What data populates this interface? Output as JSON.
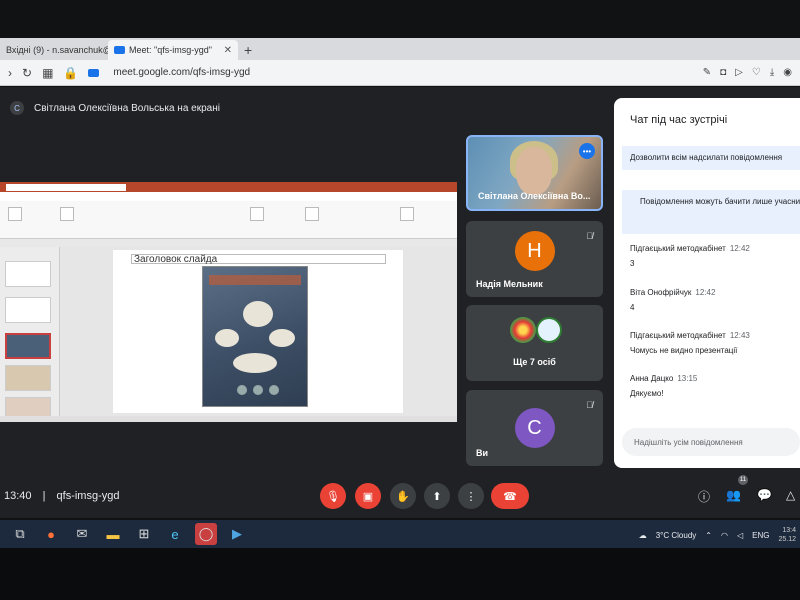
{
  "browser": {
    "tabs": [
      {
        "label": "Вхідні (9) - n.savanchuk@...",
        "active": false
      },
      {
        "label": "Meet: \"qfs-imsg-ygd\"",
        "active": true
      }
    ],
    "new_tab": "+",
    "url": "meet.google.com/qfs-imsg-ygd"
  },
  "meet": {
    "presenter_initial": "С",
    "presenting_text": "Світлана Олексіївна Вольська на екрані",
    "shared_slide_title": "Заголовок слайда",
    "tiles": [
      {
        "name": "Світлана Олексіївна Во...",
        "type": "video"
      },
      {
        "name": "Надія Мельник",
        "initial": "Н",
        "color": "#e8710a"
      },
      {
        "name": "Ще 7 осіб",
        "type": "group"
      },
      {
        "name": "Ви",
        "initial": "С",
        "color": "#7e57c2"
      }
    ],
    "meeting_time": "13:40",
    "meeting_code": "qfs-imsg-ygd",
    "participants_badge": "11",
    "chat": {
      "title": "Чат під час зустрічі",
      "toggle_label": "Дозволити всім надсилати повідомлення",
      "notice": "Повідомлення можуть бачити лише учасники зустрічі. Коли зустріч завершується, повідомлення видаляються.",
      "messages": [
        {
          "author": "Підгаєцький методкабінет",
          "time": "12:42",
          "text": "3"
        },
        {
          "author": "Віта Онофрійчук",
          "time": "12:42",
          "text": "4"
        },
        {
          "author": "Підгаєцький методкабінет",
          "time": "12:43",
          "text": "Чомусь не видно презентації"
        },
        {
          "author": "Анна Дацко",
          "time": "13:15",
          "text": "Дякуємо!"
        }
      ],
      "input_placeholder": "Надішліть усім повідомлення"
    }
  },
  "taskbar": {
    "weather": "3°C  Cloudy",
    "language": "ENG",
    "time": "13:4",
    "date": "25.12"
  }
}
